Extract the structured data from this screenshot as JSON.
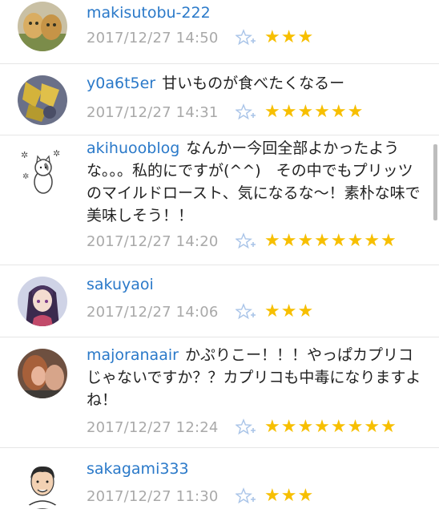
{
  "comments": [
    {
      "user": "makisutobu-222",
      "text": "",
      "time": "2017/12/27 14:50",
      "stars": "★★★",
      "avatar": "dogs-avatar"
    },
    {
      "user": "y0a6t5er",
      "text": "甘いものが食べたくなるー",
      "time": "2017/12/27 14:31",
      "stars": "★★★★★★",
      "avatar": "pattern-avatar"
    },
    {
      "user": "akihuooblog",
      "text": "なんかー今回全部よかったような。。。私的にですが(^^)　その中でもプリッツのマイルドロースト、気になるな～！素朴な味で美味しそう！！",
      "time": "2017/12/27 14:20",
      "stars": "★★★★★★★★",
      "avatar": "cat-avatar"
    },
    {
      "user": "sakuyaoi",
      "text": "",
      "time": "2017/12/27 14:06",
      "stars": "★★★",
      "avatar": "anime-avatar"
    },
    {
      "user": "majoranaair",
      "text": "かぷりこー！！！やっぱカプリコじゃないですか？？カプリコも中毒になりますよね！",
      "time": "2017/12/27 12:24",
      "stars": "★★★★★★★★",
      "avatar": "photo-avatar"
    },
    {
      "user": "sakagami333",
      "text": "",
      "time": "2017/12/27 11:30",
      "stars": "★★★",
      "avatar": "man-avatar"
    }
  ],
  "colors": {
    "username": "#2a79c9",
    "star": "#f7bf00",
    "add_star": "#a9c4e8",
    "time": "#a9a9a9"
  },
  "icons": {
    "add_star": "add-star-icon"
  }
}
